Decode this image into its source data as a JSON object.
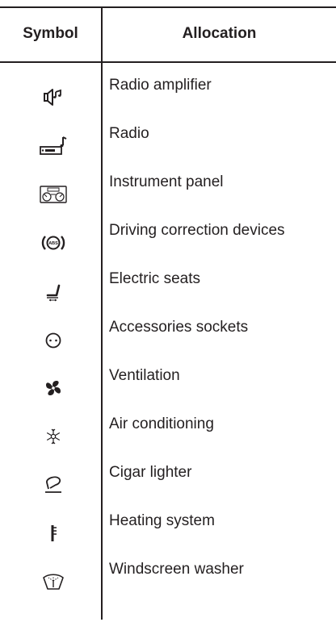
{
  "table": {
    "header": {
      "symbol": "Symbol",
      "allocation": "Allocation"
    },
    "rows": [
      {
        "icon": "radio-amplifier-icon",
        "label": "Radio amplifier"
      },
      {
        "icon": "radio-icon",
        "label": "Radio"
      },
      {
        "icon": "instrument-panel-icon",
        "label": "Instrument panel"
      },
      {
        "icon": "abs-icon",
        "label": "Driving correction devices"
      },
      {
        "icon": "electric-seat-icon",
        "label": "Electric seats"
      },
      {
        "icon": "accessory-socket-icon",
        "label": "Accessories sockets"
      },
      {
        "icon": "fan-icon",
        "label": "Ventilation"
      },
      {
        "icon": "snowflake-icon",
        "label": "Air conditioning"
      },
      {
        "icon": "cigar-lighter-icon",
        "label": "Cigar lighter"
      },
      {
        "icon": "thermometer-icon",
        "label": "Heating system"
      },
      {
        "icon": "windscreen-washer-icon",
        "label": "Windscreen washer"
      }
    ]
  }
}
